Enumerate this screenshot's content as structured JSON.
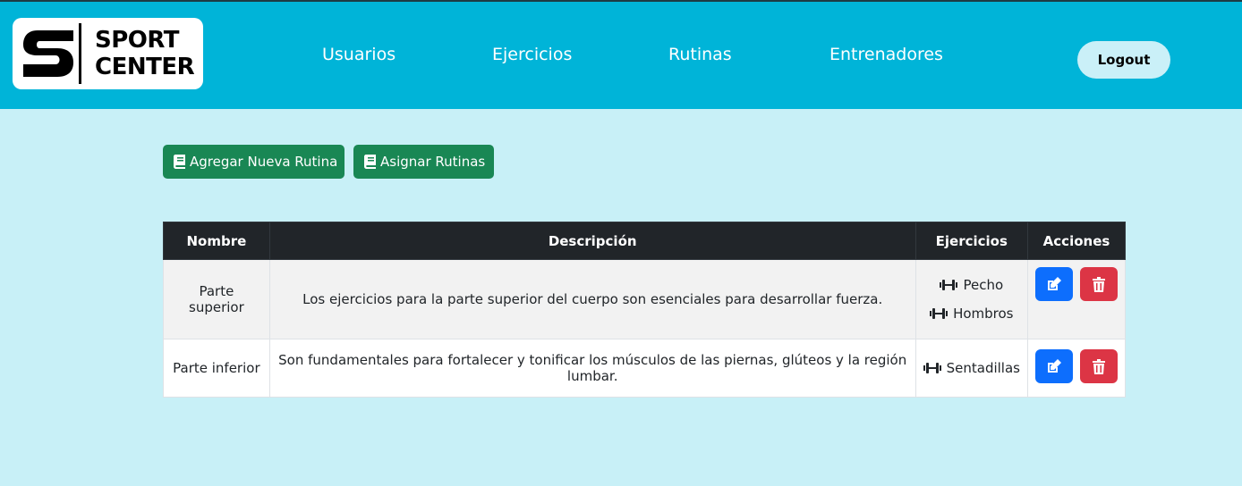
{
  "brand": {
    "line1": "SPORT",
    "line2": "CENTER"
  },
  "nav": {
    "items": [
      {
        "label": "Usuarios"
      },
      {
        "label": "Ejercicios"
      },
      {
        "label": "Rutinas"
      },
      {
        "label": "Entrenadores"
      }
    ],
    "logout_label": "Logout"
  },
  "actions": {
    "add_label": "Agregar Nueva Rutina",
    "assign_label": "Asignar Rutinas"
  },
  "table": {
    "headers": [
      "Nombre",
      "Descripción",
      "Ejercicios",
      "Acciones"
    ],
    "rows": [
      {
        "nombre": "Parte superior",
        "descripcion": "Los ejercicios para la parte superior del cuerpo son esenciales para desarrollar fuerza.",
        "ejercicios": [
          "Pecho",
          "Hombros"
        ]
      },
      {
        "nombre": "Parte inferior",
        "descripcion": "Son fundamentales para fortalecer y tonificar los músculos de las piernas, glúteos y la región lumbar.",
        "ejercicios": [
          "Sentadillas"
        ]
      }
    ]
  },
  "colors": {
    "navbar": "#00b4d8",
    "background": "#c8f0f7",
    "green_button": "#198754",
    "edit_button": "#0d6efd",
    "delete_button": "#dc3545",
    "table_header": "#212529"
  },
  "icons": {
    "add": "book-icon",
    "assign": "book-icon",
    "exercise": "dumbbell-icon",
    "edit": "edit-icon",
    "delete": "trash-icon"
  }
}
